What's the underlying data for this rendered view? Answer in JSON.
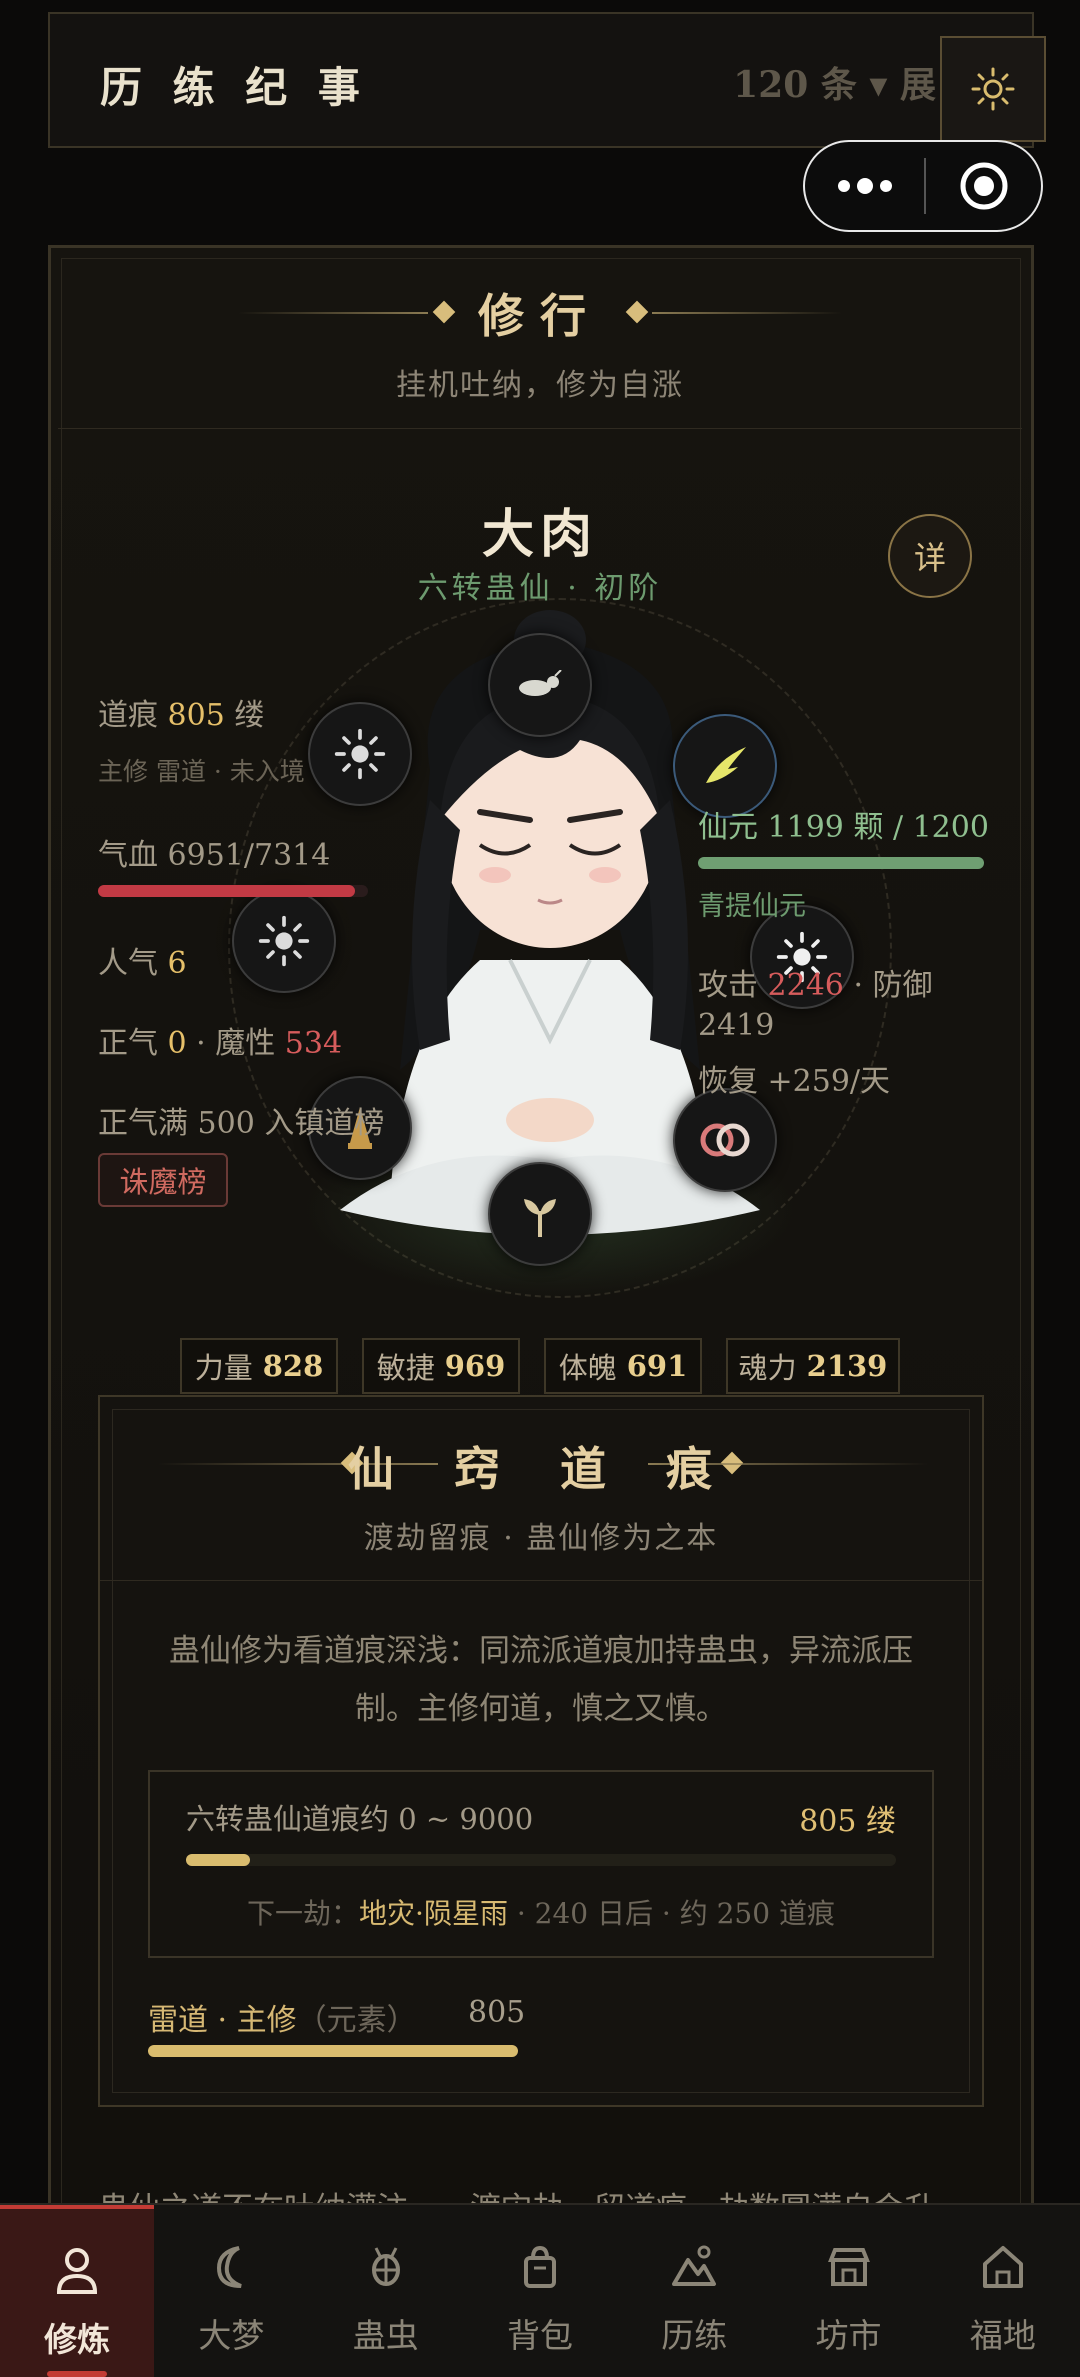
{
  "top_bar": {
    "title": "历 练 纪 事",
    "count_label": "120 条 ▾ 展",
    "theme_icon": "sun-icon"
  },
  "capsule": {
    "more_icon": "more-dots-icon",
    "close_icon": "target-icon"
  },
  "practice": {
    "title": "修行",
    "subtitle": "挂机吐纳，修为自涨",
    "character": {
      "name": "大肉",
      "rank": "六转蛊仙 · 初阶",
      "detail_label": "详"
    },
    "left_stats": {
      "daohen_label": "道痕 ",
      "daohen_value": "805",
      "daohen_unit": " 缕",
      "main_path_note": "主修 雷道 · 未入境",
      "hp_label": "气血 6951/7314",
      "hp_current": 6951,
      "hp_max": 7314,
      "popularity_label": "人气 ",
      "popularity_value": "6",
      "righteous_label": "正气 ",
      "righteous_value": "0",
      "demonic_label": " · 魔性 ",
      "demonic_value": "534",
      "hint": "正气满 500 入镇道榜",
      "tag_label": "诛魔榜"
    },
    "right_stats": {
      "essence_label": "仙元 1199 颗 / 1200",
      "essence_current": 1199,
      "essence_max": 1200,
      "essence_type": "青提仙元",
      "attack_label": "攻击 ",
      "attack_value": "2246",
      "defense_label": " · 防御",
      "defense_value": "2419",
      "recover_label": "恢复 +259/天"
    },
    "orbs": [
      "bug-icon",
      "sun-icon",
      "lightning-icon",
      "sun-icon",
      "sun-icon",
      "gourd-icon",
      "rings-icon",
      "sprout-icon"
    ],
    "attributes": [
      {
        "label": "力量",
        "value": "828"
      },
      {
        "label": "敏捷",
        "value": "969"
      },
      {
        "label": "体魄",
        "value": "691"
      },
      {
        "label": "魂力",
        "value": "2139"
      }
    ]
  },
  "daohen_section": {
    "title": "仙 窍 道 痕",
    "subtitle": "渡劫留痕 · 蛊仙修为之本",
    "description": "蛊仙修为看道痕深浅：同流派道痕加持蛊虫，异流派压制。主修何道，慎之又慎。",
    "progress": {
      "label": "六转蛊仙道痕约 0 ~ 9000",
      "value_label": "805 缕",
      "value": 805,
      "max": 9000,
      "next_prefix": "下一劫：",
      "next_event": "地灾·陨星雨",
      "next_suffix": " · 240 日后 · 约 250 道痕"
    },
    "main_path": {
      "label": "雷道 · 主修",
      "kind": "（元素）",
      "value": "805"
    }
  },
  "footer_text": "蛊仙之道不在吐纳灌注……渡灾劫，留道痕，劫数圆满自会升",
  "tabs": [
    {
      "label": "修炼",
      "icon": "person-icon",
      "active": true
    },
    {
      "label": "大梦",
      "icon": "moon-icon",
      "active": false
    },
    {
      "label": "蛊虫",
      "icon": "bug-icon",
      "active": false
    },
    {
      "label": "背包",
      "icon": "bag-icon",
      "active": false
    },
    {
      "label": "历练",
      "icon": "mountain-icon",
      "active": false
    },
    {
      "label": "坊市",
      "icon": "shop-icon",
      "active": false
    },
    {
      "label": "福地",
      "icon": "home-icon",
      "active": false
    }
  ],
  "colors": {
    "accent_gold": "#d9bc6e",
    "hp_red": "#c23a44",
    "essence_green": "#6f9f72",
    "active_tab_red": "#c33b35"
  }
}
